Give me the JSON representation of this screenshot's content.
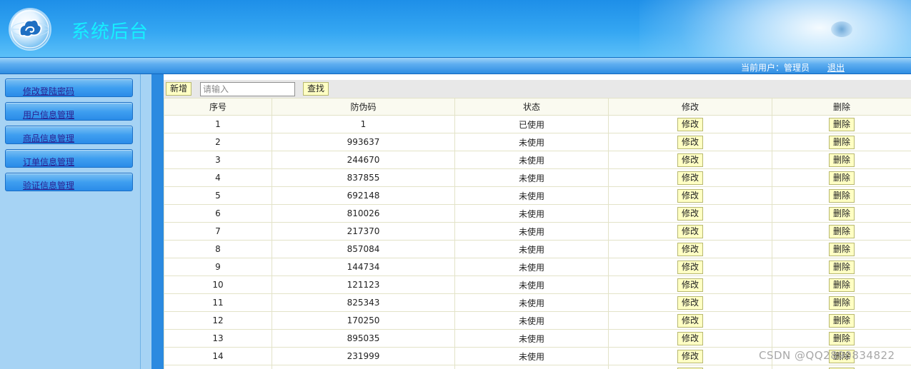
{
  "header": {
    "title": "系统后台",
    "current_user": "当前用户：管理员",
    "logout": "退出"
  },
  "sidebar": {
    "items": [
      {
        "label": "修改登陆密码"
      },
      {
        "label": "用户信息管理"
      },
      {
        "label": "商品信息管理"
      },
      {
        "label": "订单信息管理"
      },
      {
        "label": "验证信息管理"
      }
    ]
  },
  "toolbar": {
    "add_label": "新增",
    "search_placeholder": "请输入",
    "search_label": "查找"
  },
  "table": {
    "columns": [
      "序号",
      "防伪码",
      "状态",
      "修改",
      "删除"
    ],
    "edit_label": "修改",
    "delete_label": "删除",
    "rows": [
      {
        "id": "1",
        "code": "1",
        "status": "已使用"
      },
      {
        "id": "2",
        "code": "993637",
        "status": "未使用"
      },
      {
        "id": "3",
        "code": "244670",
        "status": "未使用"
      },
      {
        "id": "4",
        "code": "837855",
        "status": "未使用"
      },
      {
        "id": "5",
        "code": "692148",
        "status": "未使用"
      },
      {
        "id": "6",
        "code": "810026",
        "status": "未使用"
      },
      {
        "id": "7",
        "code": "217370",
        "status": "未使用"
      },
      {
        "id": "8",
        "code": "857084",
        "status": "未使用"
      },
      {
        "id": "9",
        "code": "144734",
        "status": "未使用"
      },
      {
        "id": "10",
        "code": "121123",
        "status": "未使用"
      },
      {
        "id": "11",
        "code": "825343",
        "status": "未使用"
      },
      {
        "id": "12",
        "code": "170250",
        "status": "未使用"
      },
      {
        "id": "13",
        "code": "895035",
        "status": "未使用"
      },
      {
        "id": "14",
        "code": "231999",
        "status": "未使用"
      },
      {
        "id": "",
        "code": "",
        "status": ""
      }
    ]
  },
  "watermark": "CSDN @QQ2890834822",
  "colors": {
    "header_blue": "#34a6f2",
    "title_cyan": "#16f0ff",
    "button_yellow": "#ffffc4",
    "sidebar_blue": "#a6d3f4"
  }
}
